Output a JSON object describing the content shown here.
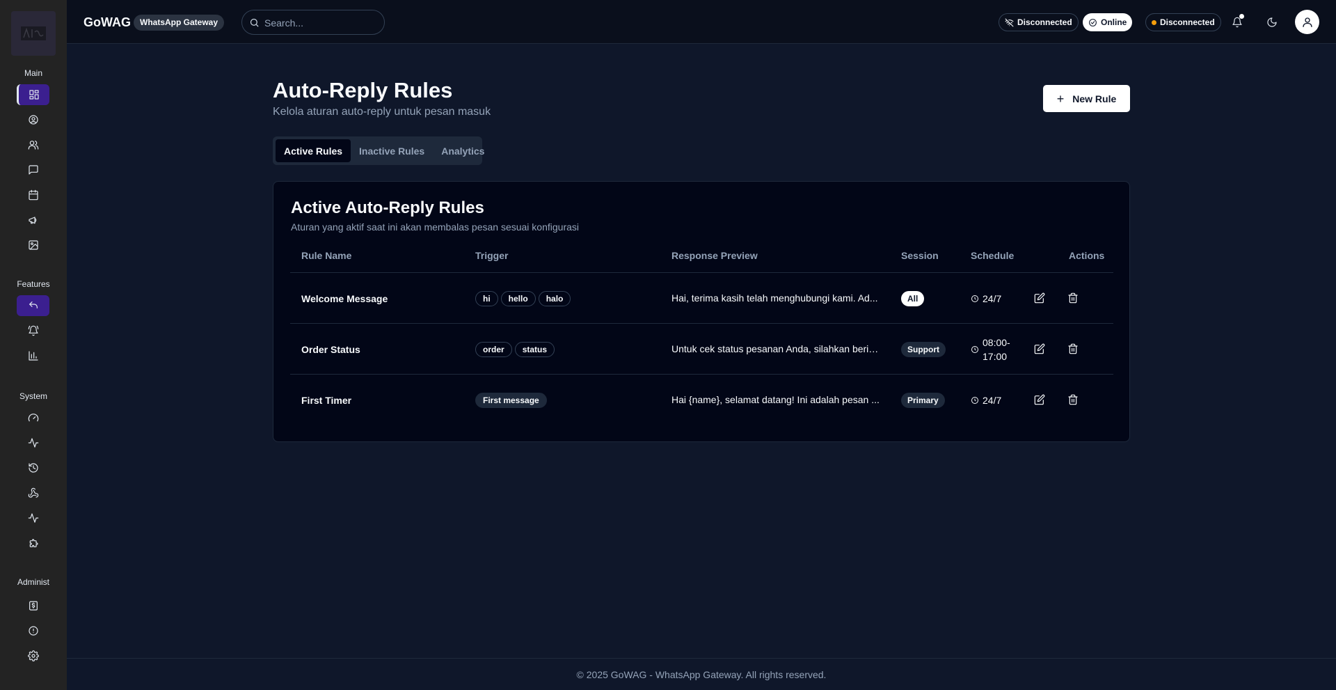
{
  "sidebar": {
    "logo_alt": "GoWAG logo",
    "sections": {
      "main": "Main",
      "features": "Features",
      "system": "System",
      "admin": "Administ"
    },
    "icons": {
      "main": [
        "dashboard-icon",
        "user-circle-icon",
        "users-icon",
        "message-icon",
        "calendar-icon",
        "megaphone-icon",
        "image-icon"
      ],
      "features": [
        "reply-icon",
        "bell-ring-icon",
        "bar-chart-icon"
      ],
      "system": [
        "gauge-icon",
        "activity-icon",
        "history-icon",
        "webhook-icon",
        "pulse-icon",
        "puzzle-icon"
      ],
      "admin": [
        "billing-icon",
        "alert-circle-icon",
        "settings-icon"
      ]
    },
    "active_main": 0,
    "active_features": 0
  },
  "header": {
    "brand": "GoWAG",
    "brand_badge": "WhatsApp Gateway",
    "search_placeholder": "Search...",
    "status": {
      "ws": "Disconnected",
      "online": "Online",
      "whatsapp": "Disconnected",
      "whatsapp_color": "#f59e0b"
    }
  },
  "page": {
    "title": "Auto-Reply Rules",
    "subtitle": "Kelola aturan auto-reply untuk pesan masuk",
    "new_rule_label": "New Rule",
    "tabs": [
      "Active Rules",
      "Inactive Rules",
      "Analytics"
    ],
    "active_tab": 0
  },
  "card": {
    "title": "Active Auto-Reply Rules",
    "subtitle": "Aturan yang aktif saat ini akan membalas pesan sesuai konfigurasi",
    "columns": [
      "Rule Name",
      "Trigger",
      "Response Preview",
      "Session",
      "Schedule",
      "Actions"
    ],
    "rows": [
      {
        "name": "Welcome Message",
        "triggers": [
          "hi",
          "hello",
          "halo"
        ],
        "preview": "Hai, terima kasih telah menghubungi kami. Ad...",
        "session": "All",
        "schedule": "24/7"
      },
      {
        "name": "Order Status",
        "triggers": [
          "order",
          "status"
        ],
        "preview": "Untuk cek status pesanan Anda, silahkan berik...",
        "session": "Support",
        "schedule": "08:00-17:00"
      },
      {
        "name": "First Timer",
        "triggers": [
          "First message"
        ],
        "preview": "Hai {name}, selamat datang! Ini adalah pesan ...",
        "session": "Primary",
        "schedule": "24/7"
      }
    ]
  },
  "footer": {
    "text": "© 2025 GoWAG - WhatsApp Gateway. All rights reserved."
  }
}
